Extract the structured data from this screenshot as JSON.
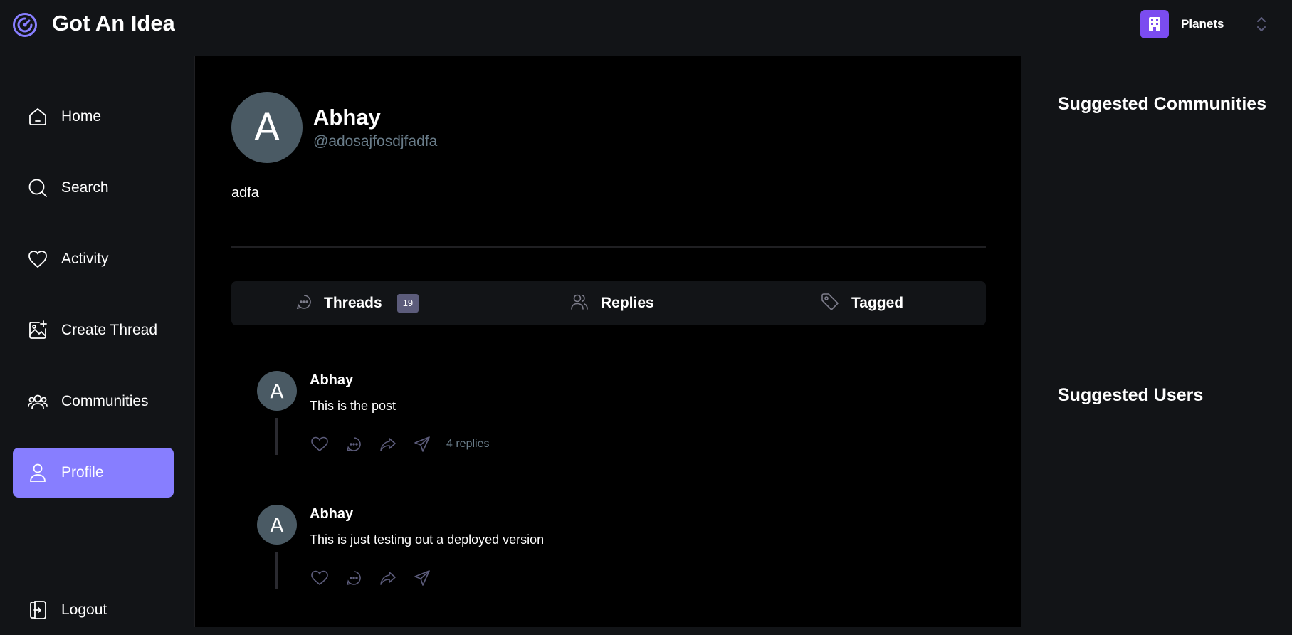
{
  "app": {
    "title": "Got An Idea",
    "logo_icon": "logo-icon"
  },
  "org_switcher": {
    "name": "Planets",
    "icon": "building-icon",
    "accent": "#7b4cf0"
  },
  "sidebar": {
    "items": [
      {
        "label": "Home",
        "icon": "home-icon"
      },
      {
        "label": "Search",
        "icon": "search-icon"
      },
      {
        "label": "Activity",
        "icon": "heart-icon"
      },
      {
        "label": "Create Thread",
        "icon": "create-thread-icon"
      },
      {
        "label": "Communities",
        "icon": "communities-icon"
      },
      {
        "label": "Profile",
        "icon": "user-icon",
        "active": true
      }
    ],
    "logout": {
      "label": "Logout",
      "icon": "logout-icon"
    },
    "active_color": "#877eff"
  },
  "profile": {
    "avatar_initial": "A",
    "name": "Abhay",
    "handle": "@adosajfosdjfadfa",
    "bio": "adfa"
  },
  "tabs": [
    {
      "label": "Threads",
      "icon": "chat-bubble-icon",
      "badge": "19"
    },
    {
      "label": "Replies",
      "icon": "users-icon"
    },
    {
      "label": "Tagged",
      "icon": "tag-icon"
    }
  ],
  "threads": [
    {
      "avatar_initial": "A",
      "author": "Abhay",
      "text": "This is the post",
      "replies": "4 replies"
    },
    {
      "avatar_initial": "A",
      "author": "Abhay",
      "text": "This is just testing out a deployed version",
      "replies": ""
    }
  ],
  "rightbar": {
    "suggested_communities": "Suggested Communities",
    "suggested_users": "Suggested Users"
  }
}
